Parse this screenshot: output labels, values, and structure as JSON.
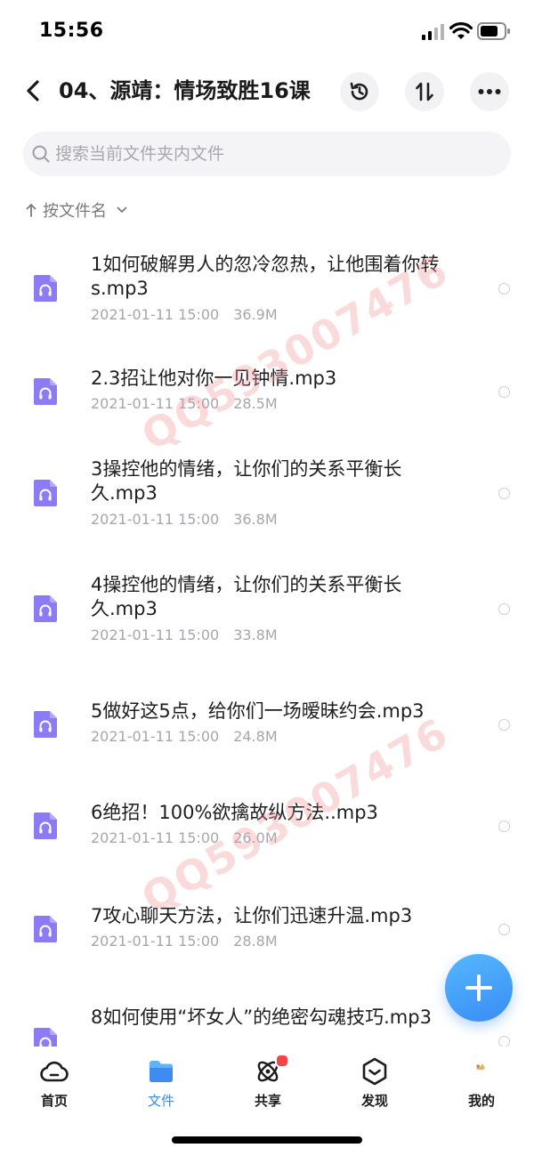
{
  "status_bar": {
    "time": "15:56"
  },
  "header": {
    "title": "04、源靖：情场致胜16课",
    "icons": [
      "back-icon",
      "history-icon",
      "sort-icon",
      "more-icon"
    ]
  },
  "search": {
    "placeholder": "搜索当前文件夹内文件"
  },
  "sort": {
    "label": "按文件名"
  },
  "files": [
    {
      "name": "1如何破解男人的忽冷忽热，让他围着你转s.mp3",
      "date": "2021-01-11 15:00",
      "size": "36.9M"
    },
    {
      "name": "2.3招让他对你一见钟情.mp3",
      "date": "2021-01-11 15:00",
      "size": "28.5M"
    },
    {
      "name": "3操控他的情绪，让你们的关系平衡长久.mp3",
      "date": "2021-01-11 15:00",
      "size": "36.8M"
    },
    {
      "name": "4操控他的情绪，让你们的关系平衡长久.mp3",
      "date": "2021-01-11 15:00",
      "size": "33.8M"
    },
    {
      "name": "5做好这5点，给你们一场暧昧约会.mp3",
      "date": "2021-01-11 15:00",
      "size": "24.8M"
    },
    {
      "name": "6绝招！100%欲擒故纵方法..mp3",
      "date": "2021-01-11 15:00",
      "size": "26.0M"
    },
    {
      "name": "7攻心聊天方法，让你们迅速升温.mp3",
      "date": "2021-01-11 15:00",
      "size": "28.8M"
    },
    {
      "name": "8如何使用“坏女人”的绝密勾魂技巧.mp3",
      "date": "",
      "size": ""
    }
  ],
  "watermark": "QQ593007476",
  "tabs": [
    {
      "label": "首页",
      "icon": "cloud-icon"
    },
    {
      "label": "文件",
      "icon": "folder-icon"
    },
    {
      "label": "共享",
      "icon": "atom-icon"
    },
    {
      "label": "发现",
      "icon": "compass-icon"
    },
    {
      "label": "我的",
      "icon": "profile-icon"
    }
  ],
  "colors": {
    "accent": "#3d8bf3",
    "file_icon": "#8b7cf6",
    "badge": "#f0464a"
  }
}
